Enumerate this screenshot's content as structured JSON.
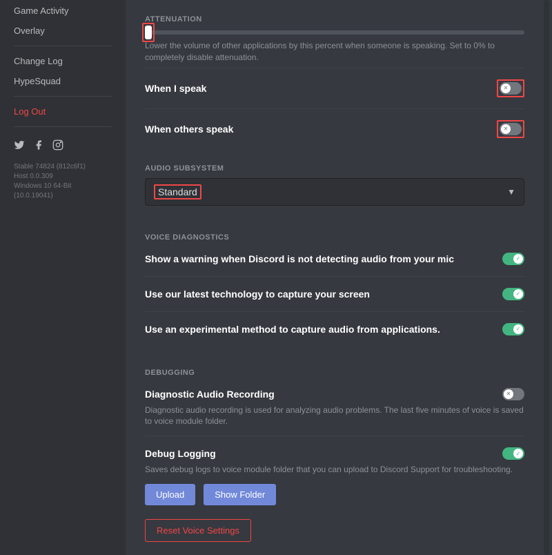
{
  "sidebar": {
    "items": [
      "Game Activity",
      "Overlay",
      "Change Log",
      "HypeSquad"
    ],
    "logout": "Log Out",
    "version": [
      "Stable 74824 (812c6f1)",
      "Host 0.0.309",
      "Windows 10 64-Bit (10.0.19041)"
    ]
  },
  "attenuation": {
    "label": "ATTENUATION",
    "desc": "Lower the volume of other applications by this percent when someone is speaking. Set to 0% to completely disable attenuation.",
    "whenISpeak": "When I speak",
    "whenOthersSpeak": "When others speak"
  },
  "audioSubsystem": {
    "label": "AUDIO SUBSYSTEM",
    "value": "Standard"
  },
  "voiceDiagnostics": {
    "label": "VOICE DIAGNOSTICS",
    "micWarning": "Show a warning when Discord is not detecting audio from your mic",
    "screenCapture": "Use our latest technology to capture your screen",
    "audioCapture": "Use an experimental method to capture audio from applications."
  },
  "debugging": {
    "label": "DEBUGGING",
    "diagRecording": "Diagnostic Audio Recording",
    "diagDesc": "Diagnostic audio recording is used for analyzing audio problems. The last five minutes of voice is saved to voice module folder.",
    "debugLogging": "Debug Logging",
    "debugDesc": "Saves debug logs to voice module folder that you can upload to Discord Support for troubleshooting.",
    "upload": "Upload",
    "showFolder": "Show Folder"
  },
  "reset": "Reset Voice Settings"
}
